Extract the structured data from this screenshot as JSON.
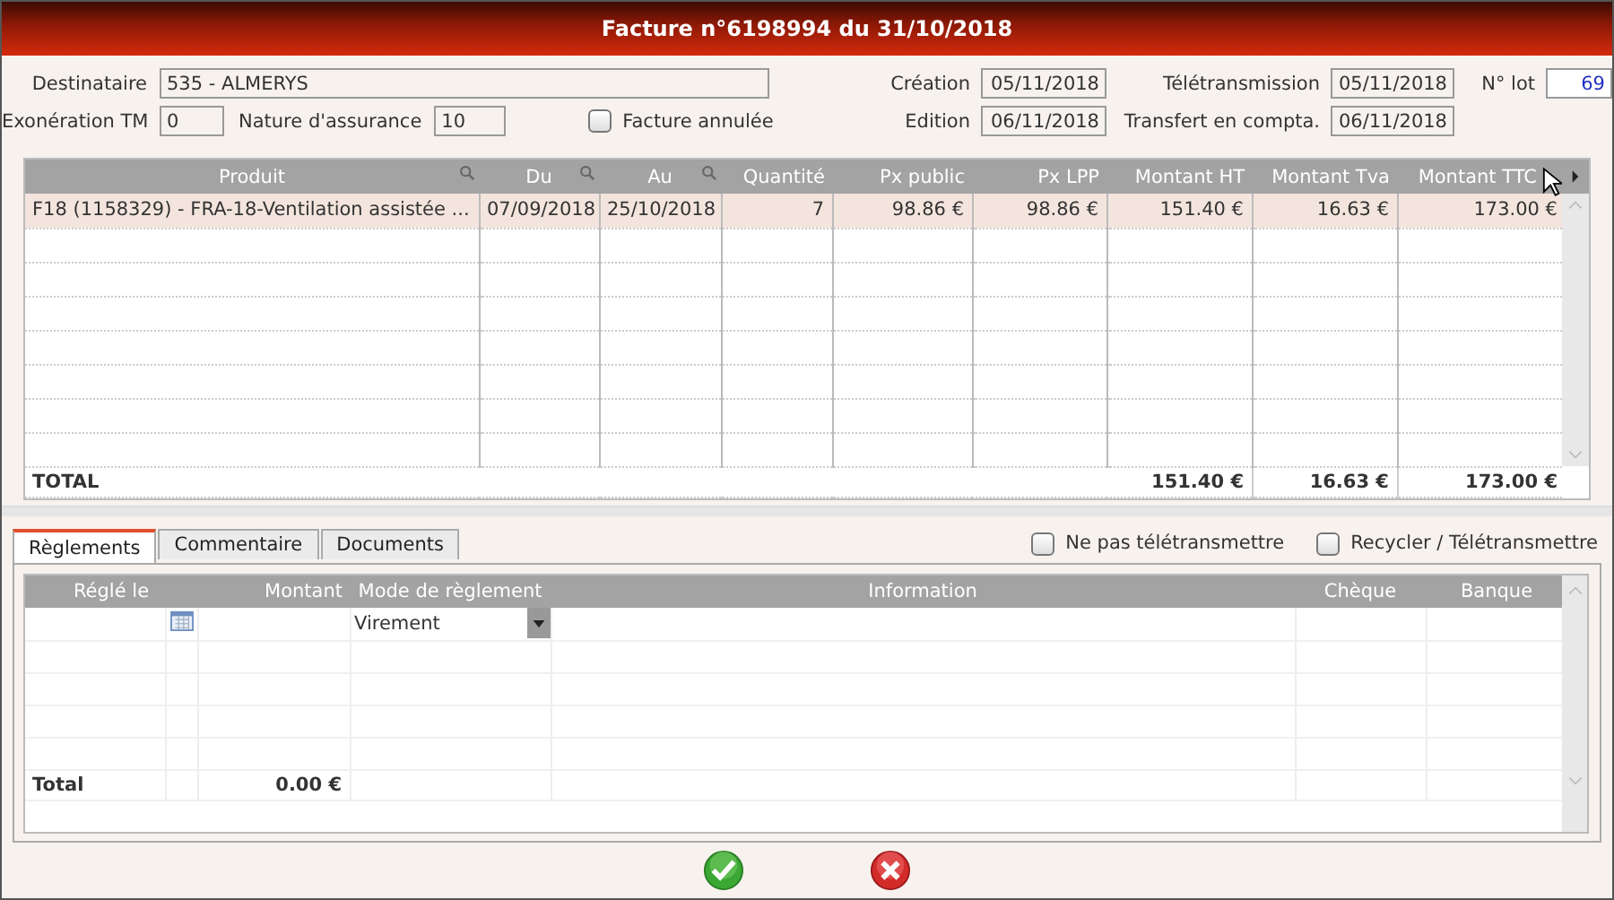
{
  "window": {
    "title": "Facture n°6198994 du 31/10/2018"
  },
  "form": {
    "destinataire": {
      "label": "Destinataire",
      "value": "535 - ALMERYS"
    },
    "exoneration": {
      "label": "Exonération TM",
      "value": "0"
    },
    "nature": {
      "label": "Nature d'assurance",
      "value": "10"
    },
    "facture_annulee": {
      "label": "Facture annulée",
      "checked": false
    },
    "creation": {
      "label": "Création",
      "value": "05/11/2018"
    },
    "teletransmission": {
      "label": "Télétransmission",
      "value": "05/11/2018"
    },
    "no_lot": {
      "label": "N° lot",
      "value": "69"
    },
    "edition": {
      "label": "Edition",
      "value": "06/11/2018"
    },
    "transfert": {
      "label": "Transfert en compta.",
      "value": "06/11/2018"
    }
  },
  "table": {
    "columns": [
      {
        "label": "Produit",
        "searchable": true
      },
      {
        "label": "Du",
        "searchable": true
      },
      {
        "label": "Au",
        "searchable": true
      },
      {
        "label": "Quantité",
        "searchable": false
      },
      {
        "label": "Px public",
        "searchable": false
      },
      {
        "label": "Px LPP",
        "searchable": false
      },
      {
        "label": "Montant HT",
        "searchable": false
      },
      {
        "label": "Montant Tva",
        "searchable": false
      },
      {
        "label": "Montant TTC",
        "searchable": false
      }
    ],
    "rows": [
      {
        "selected": true,
        "cells": [
          "F18 (1158329) - FRA-18-Ventilation assistée ...",
          "07/09/2018",
          "25/10/2018",
          "7",
          "98.86 €",
          "98.86 €",
          "151.40 €",
          "16.63 €",
          "173.00 €"
        ]
      }
    ],
    "total": {
      "label": "TOTAL",
      "amounts": [
        "151.40 €",
        "16.63 €",
        "173.00 €"
      ]
    }
  },
  "tabs": [
    {
      "label": "Règlements",
      "selected": true
    },
    {
      "label": "Commentaire",
      "selected": false
    },
    {
      "label": "Documents",
      "selected": false
    }
  ],
  "options": [
    {
      "label": "Ne pas télétransmettre",
      "checked": false
    },
    {
      "label": "Recycler / Télétransmettre",
      "checked": false
    }
  ],
  "payments": {
    "columns": [
      "Réglé le",
      "Montant",
      "Mode de règlement",
      "Information",
      "Chèque",
      "Banque"
    ],
    "rows": [
      {
        "mode": "Virement"
      }
    ],
    "total": {
      "label": "Total",
      "amount": "0.00 €"
    }
  },
  "buttons": [
    {
      "kind": "ok"
    },
    {
      "kind": "cancel"
    }
  ]
}
